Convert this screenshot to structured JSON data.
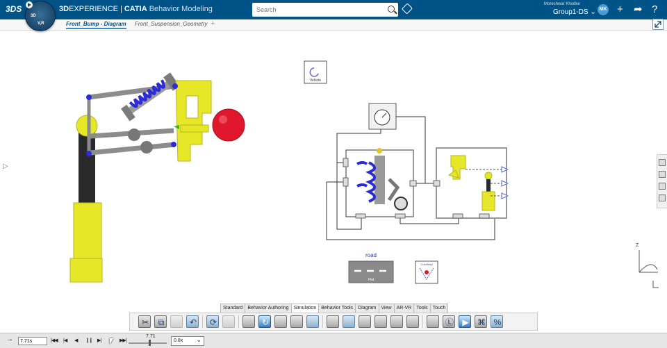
{
  "header": {
    "brand_bold": "3D",
    "brand_rest": "EXPERIENCE",
    "brand_sep": "|",
    "app_bold": "CATIA",
    "app_name": "Behavior Modeling",
    "search_placeholder": "Search",
    "user_name": "Moreshwar Khodke",
    "group": "Group1-DS",
    "avatar_initials": "MK",
    "compass_labels": [
      "3D",
      "V,R"
    ]
  },
  "tabs": [
    {
      "label": "Front_Bump - Diagram",
      "active": true
    },
    {
      "label": "Front_Suspension_Geometry",
      "active": false
    }
  ],
  "diagram": {
    "vehicle_label": "Vehicle",
    "road_title": "road",
    "road_label": "Flat",
    "colormap_label": "ColorMap"
  },
  "section_tabs": [
    "Standard",
    "Behavior Authoring",
    "Simulation",
    "Behavior Tools",
    "Diagram",
    "View",
    "AR-VR",
    "Tools",
    "Touch"
  ],
  "active_section": "Simulation",
  "player": {
    "time": "7.71s",
    "slider_value": "7.71",
    "speed": "0.8x"
  },
  "colors": {
    "topbar": "#005386",
    "accent": "#368ec4",
    "suspension_yellow": "#e7e729",
    "spring_blue": "#2b2bd9",
    "ball_red": "#e0182d"
  }
}
